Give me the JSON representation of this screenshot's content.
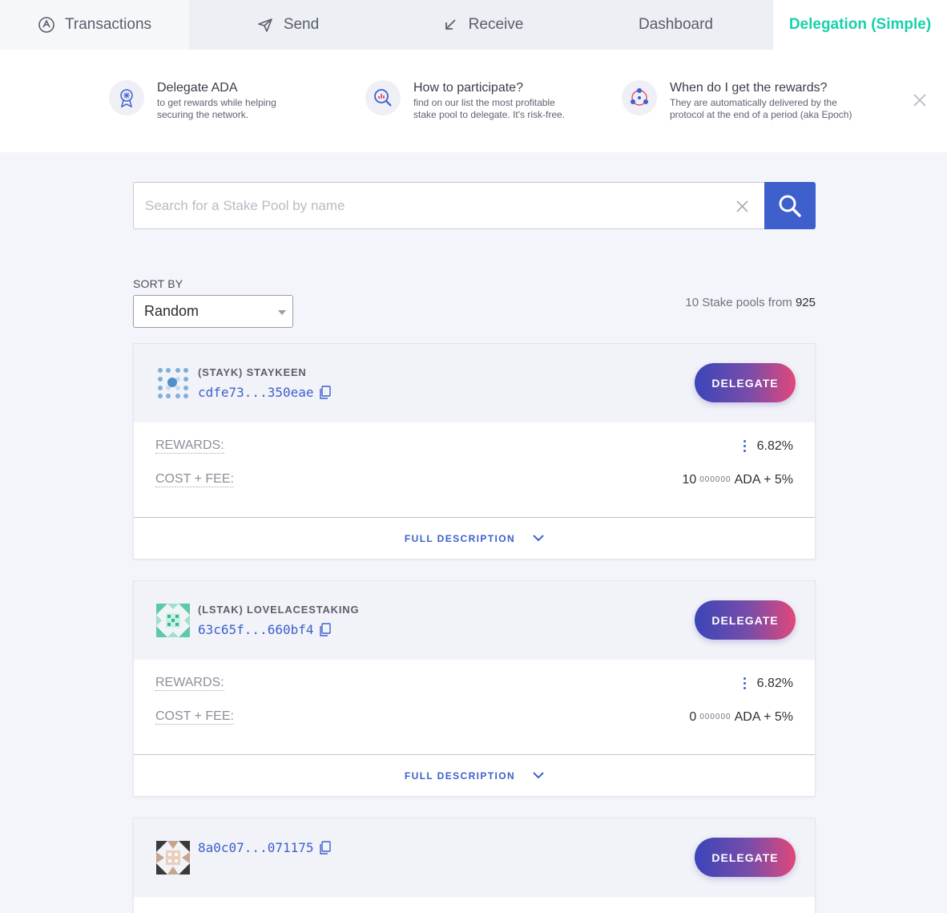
{
  "tabs": [
    {
      "label": "Transactions",
      "icon": "transactions-icon"
    },
    {
      "label": "Send",
      "icon": "send-icon"
    },
    {
      "label": "Receive",
      "icon": "receive-icon"
    },
    {
      "label": "Dashboard"
    },
    {
      "label": "Delegation (Simple)",
      "active": true
    }
  ],
  "banner": {
    "items": [
      {
        "title": "Delegate ADA",
        "desc1": "to get rewards while helping",
        "desc2": "securing the network.",
        "icon": "ribbon-icon"
      },
      {
        "title": "How to participate?",
        "desc1": "find on our list the most profitable",
        "desc2": "stake pool to delegate. It's risk-free.",
        "icon": "chart-search-icon"
      },
      {
        "title": "When do I get the rewards?",
        "desc1": "They are automatically delivered by the",
        "desc2": "protocol at the end of a period (aka Epoch)",
        "icon": "network-cycle-icon"
      }
    ]
  },
  "search": {
    "placeholder": "Search for a Stake Pool by name"
  },
  "sort": {
    "label": "SORT BY",
    "value": "Random"
  },
  "count": {
    "text": "10 Stake pools from",
    "total": "925"
  },
  "pools": [
    {
      "name": "(STAYK) STAYKEEN",
      "id": "cdfe73...350eae",
      "rewards_label": "REWARDS:",
      "rewards": "6.82%",
      "cost_label": "COST + FEE:",
      "cost_main": "10",
      "cost_zeros": "000000",
      "cost_suffix": "ADA + 5%",
      "delegate": "DELEGATE",
      "full_desc": "FULL DESCRIPTION"
    },
    {
      "name": "(LSTAK) LOVELACESTAKING",
      "id": "63c65f...660bf4",
      "rewards_label": "REWARDS:",
      "rewards": "6.82%",
      "cost_label": "COST + FEE:",
      "cost_main": "0",
      "cost_zeros": "000000",
      "cost_suffix": "ADA + 5%",
      "delegate": "DELEGATE",
      "full_desc": "FULL DESCRIPTION"
    },
    {
      "id": "8a0c07...071175",
      "delegate": "DELEGATE"
    }
  ],
  "colors": {
    "accent": "#3d60cd",
    "active_tab": "#17d1aa",
    "gradient_start": "#3a45b9",
    "gradient_end": "#e2477a"
  }
}
